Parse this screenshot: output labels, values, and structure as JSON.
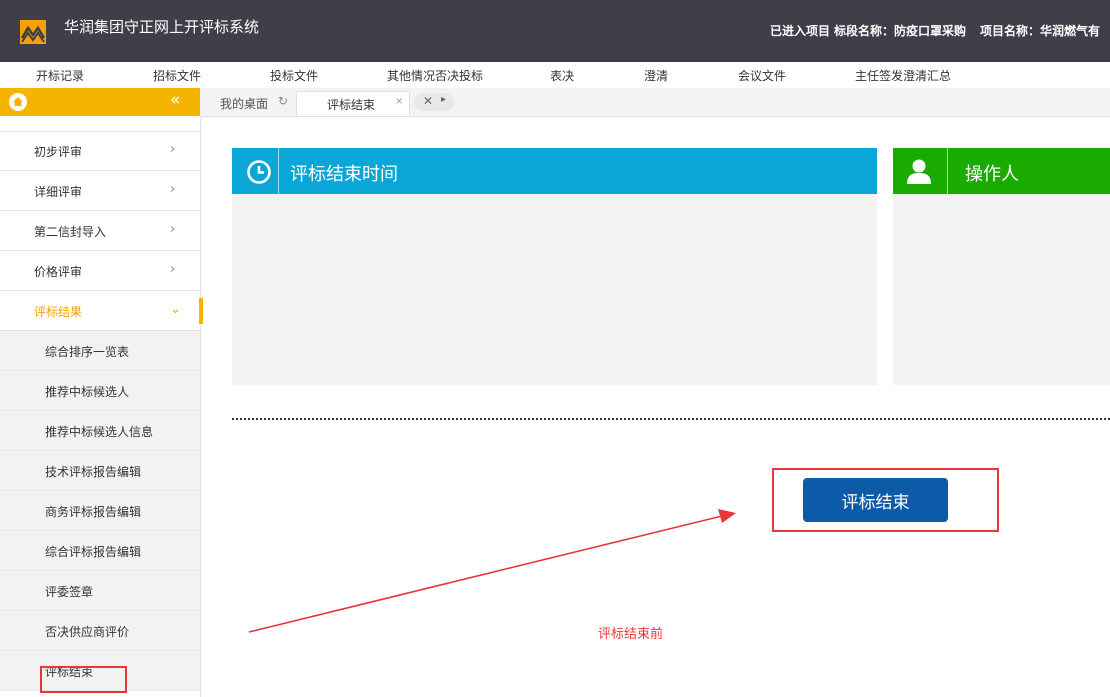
{
  "header": {
    "app_title": "华润集团守正网上开评标系统",
    "project_status": "已进入项目",
    "section_name": "标段名称：防疫口罩采购",
    "project_name": "项目名称：华润燃气有"
  },
  "menu": [
    "开标记录",
    "招标文件",
    "投标文件",
    "其他情况否决投标",
    "表决",
    "澄清",
    "会议文件",
    "主任签发澄清汇总"
  ],
  "sidebar": {
    "collapse_glyph": "«",
    "items": [
      {
        "label": "初步评审",
        "chevron": "›"
      },
      {
        "label": "详细评审",
        "chevron": "›"
      },
      {
        "label": "第二信封导入",
        "chevron": "›"
      },
      {
        "label": "价格评审",
        "chevron": "›"
      },
      {
        "label": "评标结果",
        "chevron": "⌄",
        "active": true
      }
    ],
    "sub_items": [
      "综合排序一览表",
      "推荐中标候选人",
      "推荐中标候选人信息",
      "技术评标报告编辑",
      "商务评标报告编辑",
      "综合评标报告编辑",
      "评委签章",
      "否决供应商评价",
      "评标结束"
    ]
  },
  "tabs": [
    {
      "label": "我的桌面",
      "icon": "refresh-icon",
      "glyph": "↻"
    },
    {
      "label": "评标结束",
      "icon": "close-icon",
      "glyph": "×"
    }
  ],
  "tab_controls": {
    "close_all": "✕",
    "next": "▸"
  },
  "panels": {
    "time_title": "评标结束时间",
    "time_icon": "clock-icon",
    "operator_title": "操作人",
    "operator_icon": "user-icon"
  },
  "end_button_label": "评标结束",
  "annotation_label": "评标结束前",
  "colors": {
    "topbar": "#3f3f4a",
    "sidebar_header": "#f5b400",
    "time_panel": "#0ba6d8",
    "operator_panel": "#1aab00",
    "button": "#0c5aa8",
    "annotation": "#e8373a"
  }
}
